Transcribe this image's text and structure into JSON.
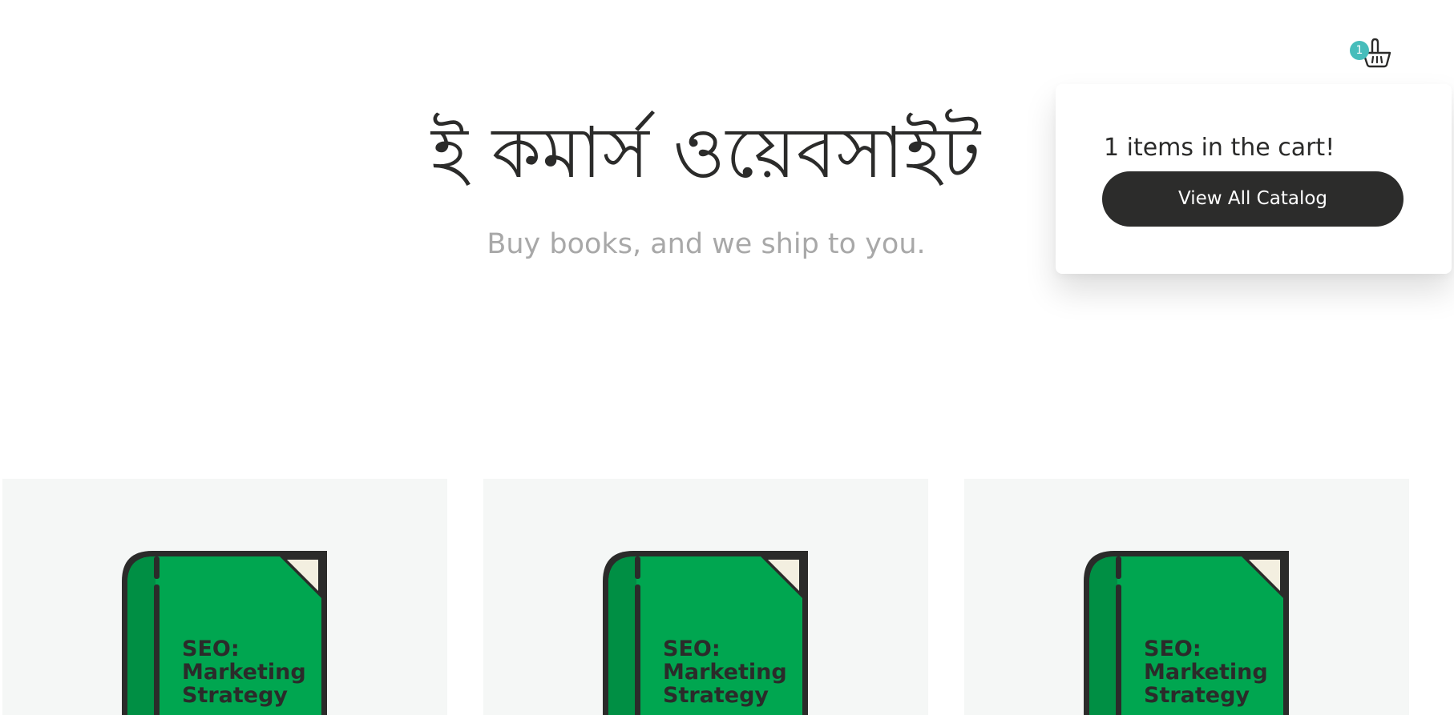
{
  "header": {
    "title": "ই কমার্স ওয়েবসাইট",
    "subtitle": "Buy books, and we ship to you."
  },
  "cart": {
    "icon": "basket-icon",
    "count": "1",
    "message": "1 items in the cart!",
    "button_label": "View All Catalog",
    "badge_color": "#46bdbb"
  },
  "products": [
    {
      "title_lines": [
        "SEO:",
        "Marketing",
        "Strategy"
      ],
      "cover_color": "#00a650"
    },
    {
      "title_lines": [
        "SEO:",
        "Marketing",
        "Strategy"
      ],
      "cover_color": "#00a650"
    },
    {
      "title_lines": [
        "SEO:",
        "Marketing",
        "Strategy"
      ],
      "cover_color": "#00a650"
    }
  ]
}
